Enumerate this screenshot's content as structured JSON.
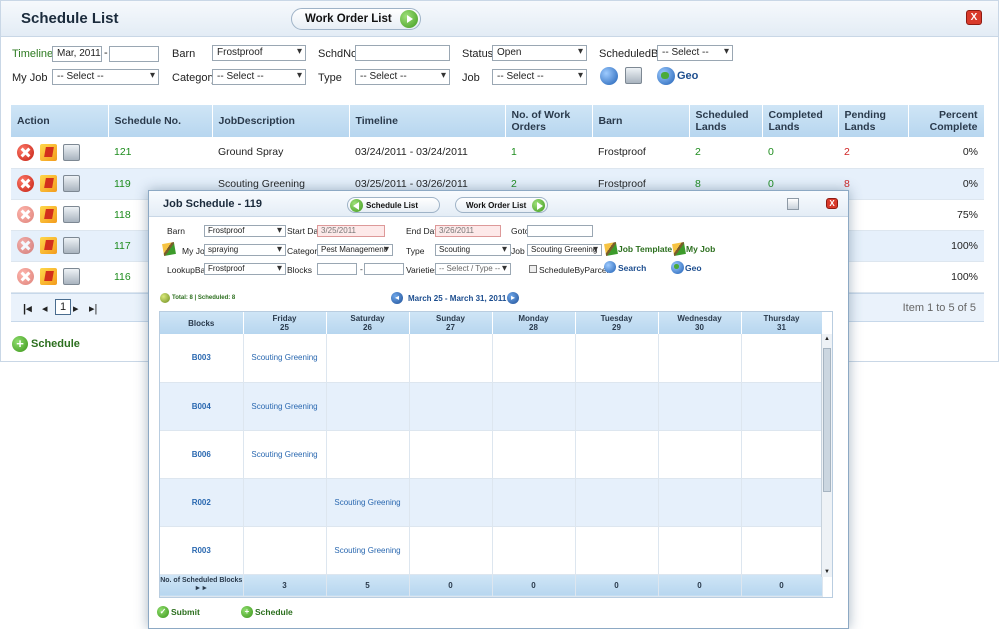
{
  "main": {
    "title": "Schedule List",
    "work_order_btn": "Work Order List",
    "close": "X",
    "filters": {
      "timeline_label": "Timeline",
      "timeline_from": "Mar, 2011",
      "timeline_sep": "-",
      "timeline_to": "",
      "barn_label": "Barn",
      "barn_value": "Frostproof",
      "schdno_label": "SchdNo",
      "schdno_value": "",
      "status_label": "Status",
      "status_value": "Open",
      "scheduledby_label": "ScheduledBy",
      "scheduledby_value": "-- Select --",
      "myjob_label": "My Job",
      "myjob_value": "-- Select --",
      "category_label": "Category",
      "category_value": "-- Select --",
      "type_label": "Type",
      "type_value": "-- Select --",
      "job_label": "Job",
      "job_value": "-- Select --",
      "geo_label": "Geo"
    },
    "columns": [
      "Action",
      "Schedule No.",
      "JobDescription",
      "Timeline",
      "No. of Work Orders",
      "Barn",
      "Scheduled Lands",
      "Completed Lands",
      "Pending Lands",
      "Percent Complete"
    ],
    "rows": [
      {
        "no": "121",
        "desc": "Ground Spray",
        "timeline": "03/24/2011 - 03/24/2011",
        "orders": "1",
        "barn": "Frostproof",
        "sched": "2",
        "comp": "0",
        "pend": "2",
        "pct": "0%"
      },
      {
        "no": "119",
        "desc": "Scouting Greening",
        "timeline": "03/25/2011 - 03/26/2011",
        "orders": "2",
        "barn": "Frostproof",
        "sched": "8",
        "comp": "0",
        "pend": "8",
        "pct": "0%"
      },
      {
        "no": "118",
        "desc": "",
        "timeline": "",
        "orders": "",
        "barn": "",
        "sched": "",
        "comp": "",
        "pend": "",
        "pct": "75%"
      },
      {
        "no": "117",
        "desc": "",
        "timeline": "",
        "orders": "",
        "barn": "",
        "sched": "",
        "comp": "",
        "pend": "",
        "pct": "100%"
      },
      {
        "no": "116",
        "desc": "",
        "timeline": "",
        "orders": "",
        "barn": "",
        "sched": "",
        "comp": "",
        "pend": "",
        "pct": "100%"
      }
    ],
    "pager": {
      "first": "K",
      "prev": "◂",
      "page": "1",
      "next": "▸",
      "last": "▸|",
      "info": "Item 1 to 5 of 5"
    },
    "add_schedule": "Schedule"
  },
  "modal": {
    "title": "Job Schedule - 119",
    "schedule_list_btn": "Schedule List",
    "work_order_btn": "Work Order List",
    "barn_label": "Barn",
    "barn_value": "Frostproof",
    "start_label": "Start Date",
    "start_value": "3/25/2011",
    "end_label": "End Date",
    "end_value": "3/26/2011",
    "goto_label": "Goto",
    "goto_value": "",
    "myjob_label": "My Job",
    "myjob_value": "spraying",
    "category_label": "Category",
    "category_value": "Pest Management",
    "type_label": "Type",
    "type_value": "Scouting",
    "job_label": "Job",
    "job_value": "Scouting Greening",
    "job_template": "Job Template",
    "my_job_btn": "My Job",
    "lookupbarn_label": "LookupBarn",
    "lookupbarn_value": "Frostproof",
    "blocks_label": "Blocks",
    "blocks_from": "",
    "blocks_sep": "-",
    "blocks_to": "",
    "varieties_label": "Varieties",
    "varieties_value": "-- Select / Type --",
    "schedule_by_parcel": "ScheduleByParcel",
    "search": "Search",
    "geo": "Geo",
    "totals": "Total: 8 | Scheduled: 8",
    "range": "March 25 - March 31, 2011",
    "cal_headers": [
      {
        "d": "Blocks",
        "n": ""
      },
      {
        "d": "Friday",
        "n": "25"
      },
      {
        "d": "Saturday",
        "n": "26"
      },
      {
        "d": "Sunday",
        "n": "27"
      },
      {
        "d": "Monday",
        "n": "28"
      },
      {
        "d": "Tuesday",
        "n": "29"
      },
      {
        "d": "Wednesday",
        "n": "30"
      },
      {
        "d": "Thursday",
        "n": "31"
      }
    ],
    "cal_rows": [
      {
        "block": "B003",
        "cells": [
          "Scouting Greening",
          "",
          "",
          "",
          "",
          "",
          ""
        ]
      },
      {
        "block": "B004",
        "cells": [
          "Scouting Greening",
          "",
          "",
          "",
          "",
          "",
          ""
        ]
      },
      {
        "block": "B006",
        "cells": [
          "Scouting Greening",
          "",
          "",
          "",
          "",
          "",
          ""
        ]
      },
      {
        "block": "R002",
        "cells": [
          "",
          "Scouting Greening",
          "",
          "",
          "",
          "",
          ""
        ]
      },
      {
        "block": "R003",
        "cells": [
          "",
          "Scouting Greening",
          "",
          "",
          "",
          "",
          ""
        ]
      }
    ],
    "footer_label": "No. of Scheduled Blocks ►►",
    "footer_counts": [
      "3",
      "5",
      "0",
      "0",
      "0",
      "0",
      "0"
    ],
    "submit": "Submit",
    "schedule": "Schedule",
    "close": "X"
  },
  "colors": {
    "accent_green": "#2c6f1e",
    "header_blue": "#b7d6ef",
    "close_red": "#d93a2b"
  }
}
